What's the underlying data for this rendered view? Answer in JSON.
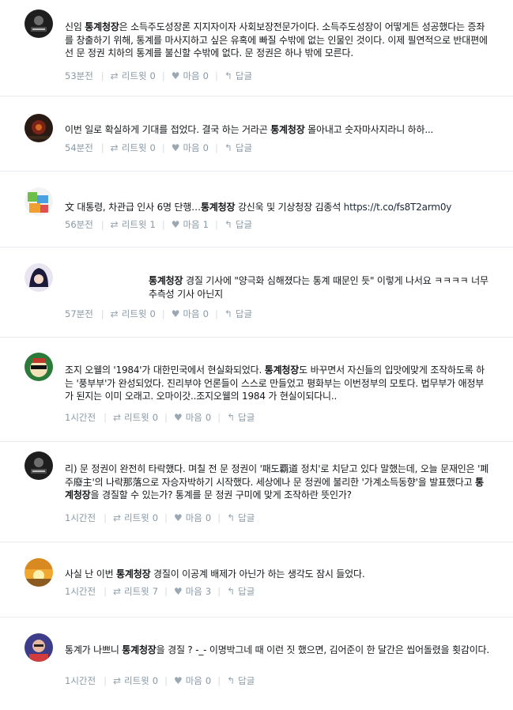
{
  "tweets": [
    {
      "name": "",
      "handle": "",
      "body": [
        {
          "t": "신임 "
        },
        {
          "t": "통계청장",
          "b": true
        },
        {
          "t": "은 소득주도성장론 지지자이자 사회보장전문가이다. 소득주도성장이 어떻게든 성공했다는 증좌를 창출하기 위해, 통계를 마사지하고 싶은 유혹에 빠질 수밖에 없는 인물인 것이다. 이제 필연적으로 반대편에선 문 정권 치하의 통계를 불신할 수밖에 없다. 문 정권은 하나 밖에 모른다."
        }
      ],
      "time": "53분전",
      "retweet_label": "리트윗",
      "retweets": "0",
      "like_label": "마음",
      "likes": "0",
      "reply_label": "답글"
    },
    {
      "name": "",
      "handle": "",
      "body": [
        {
          "t": "이번 일로 확실하게 기대를 접었다. 결국 하는 거라곤 "
        },
        {
          "t": "통계청장",
          "b": true
        },
        {
          "t": " 몰아내고 숫자마사지라니 하하..."
        }
      ],
      "time": "54분전",
      "retweet_label": "리트윗",
      "retweets": "0",
      "like_label": "마음",
      "likes": "0",
      "reply_label": "답글"
    },
    {
      "name": "",
      "handle": "",
      "body": [
        {
          "t": "文 대통령, 차관급 인사 6명 단행…"
        },
        {
          "t": "통계청장",
          "b": true
        },
        {
          "t": " 강신욱 및 기상청장 김종석 "
        },
        {
          "t": "https://t.co/fs8T2arm0y",
          "link": true
        }
      ],
      "time": "56분전",
      "retweet_label": "리트윗",
      "retweets": "1",
      "like_label": "마음",
      "likes": "1",
      "reply_label": "답글"
    },
    {
      "name": "",
      "handle": "",
      "body": [
        {
          "t": "통계청장",
          "b": true
        },
        {
          "t": " 경질 기사에 \"양극화 심해졌다는 통계 때문인 듯\" 이렇게 나서요 ㅋㅋㅋㅋ 너무 추측성 기사 아닌지"
        }
      ],
      "time": "57분전",
      "retweet_label": "리트윗",
      "retweets": "0",
      "like_label": "마음",
      "likes": "0",
      "reply_label": "답글"
    },
    {
      "name": "",
      "handle": "",
      "body": [
        {
          "t": "조지 오웰의 '1984'가 대한민국에서 현실화되었다. "
        },
        {
          "t": "통계청장",
          "b": true
        },
        {
          "t": "도 바꾸면서 자신들의 입맛에맞게 조작하도록 하는 '풍부부'가 완성되었다. 진리부야 언론들이 스스로 만들었고 평화부는 이번정부의 모토다. 법무부가 애정부가 된지는 이미 오래고. 오마이갓..조지오웰의 1984 가 현실이되다니.."
        }
      ],
      "time": "1시간전",
      "retweet_label": "리트윗",
      "retweets": "0",
      "like_label": "마음",
      "likes": "0",
      "reply_label": "답글"
    },
    {
      "name": "",
      "handle": "",
      "body": [
        {
          "t": "리) 문 정권이 완전히 타락했다. 며칠 전 문 정권이 '패도覇道 정치'로 치닫고 있다 말했는데, 오늘 문재인은 '폐주廢主'의 나락那落으로 자승자박하기 시작했다. 세상에나 문 정권에 불리한 '가계소득동향'을 발표했다고 "
        },
        {
          "t": "통계청장",
          "b": true
        },
        {
          "t": "을 경질할 수 있는가? 통계를 문 정권 구미에 맞게 조작하란 뜻인가?"
        }
      ],
      "time": "1시간전",
      "retweet_label": "리트윗",
      "retweets": "0",
      "like_label": "마음",
      "likes": "0",
      "reply_label": "답글"
    },
    {
      "name": "",
      "handle": "",
      "body": [
        {
          "t": "사실 난 이번 "
        },
        {
          "t": "통계청장",
          "b": true
        },
        {
          "t": " 경질이 이공계 배제가 아닌가 하는 생각도 잠시 들었다."
        }
      ],
      "time": "1시간전",
      "retweet_label": "리트윗",
      "retweets": "7",
      "like_label": "마음",
      "likes": "3",
      "reply_label": "답글"
    },
    {
      "name": "",
      "handle": "",
      "body": [
        {
          "t": "통계가 나쁘니 "
        },
        {
          "t": "통계청장",
          "b": true
        },
        {
          "t": "을 경질 ? -_- 이명박그네 때 이런 짓 했으면, 김어준이 한 달간은 씹어돌렸을 횟감이다."
        }
      ],
      "time": "1시간전",
      "retweet_label": "리트윗",
      "retweets": "0",
      "like_label": "마음",
      "likes": "0",
      "reply_label": "답글"
    }
  ],
  "colors": {
    "text": "#14171a",
    "meta": "#8899a6",
    "divider": "#e6ecf0"
  },
  "icons": {
    "retweet": "retweet-icon",
    "like": "heart-icon",
    "reply": "reply-icon"
  }
}
